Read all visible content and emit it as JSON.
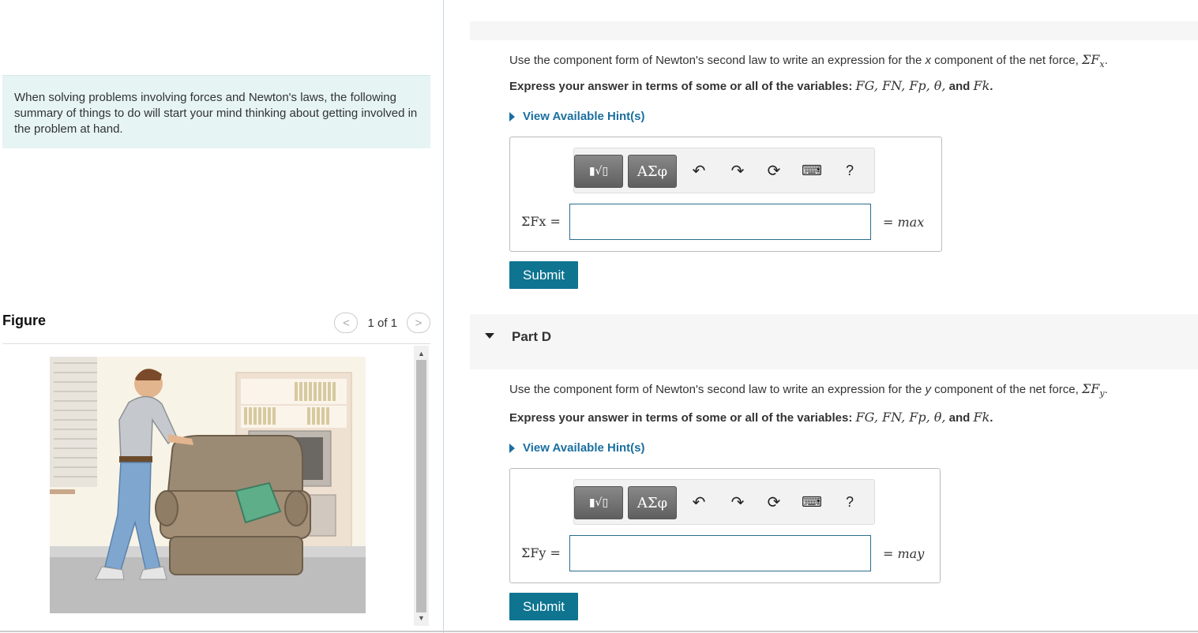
{
  "intro_text": "When solving problems involving forces and Newton's laws, the following summary of things to do will start your mind thinking about getting involved in the problem at hand.",
  "figure": {
    "title": "Figure",
    "pager_text": "1 of 1",
    "prev_label": "<",
    "next_label": ">"
  },
  "part_c": {
    "question_prefix": "Use the component form of Newton's second law to write an expression for the ",
    "question_var": "x",
    "question_suffix": " component of the net force, ",
    "question_math": "ΣF",
    "question_sub": "x",
    "express_prefix": "Express your answer in terms of some or all of the variables: ",
    "express_vars": "FG, FN, Fp, θ,",
    "express_and": " and ",
    "express_last": "Fk",
    "hint_label": "View Available Hint(s)",
    "eq_left": "ΣFx =",
    "eq_right": "= max",
    "submit_label": "Submit"
  },
  "part_d": {
    "title": "Part D",
    "question_prefix": "Use the component form of Newton's second law to write an expression for the ",
    "question_var": "y",
    "question_suffix": " component of the net force, ",
    "question_math": "ΣF",
    "question_sub": "y",
    "express_prefix": "Express your answer in terms of some or all of the variables: ",
    "express_vars": "FG, FN, Fp, θ,",
    "express_and": " and ",
    "express_last": "Fk",
    "hint_label": "View Available Hint(s)",
    "eq_left": "ΣFy =",
    "eq_right": "= may",
    "submit_label": "Submit"
  },
  "toolbar": {
    "templates_label": "▮√▯",
    "symbols_label": "ΑΣφ",
    "undo_icon": "undo-icon",
    "redo_icon": "redo-icon",
    "reset_icon": "reset-icon",
    "keyboard_icon": "keyboard-icon",
    "help_label": "?"
  },
  "colors": {
    "accent": "#0e7490",
    "link": "#1a6fa0",
    "intro_bg": "#e6f4f4"
  }
}
